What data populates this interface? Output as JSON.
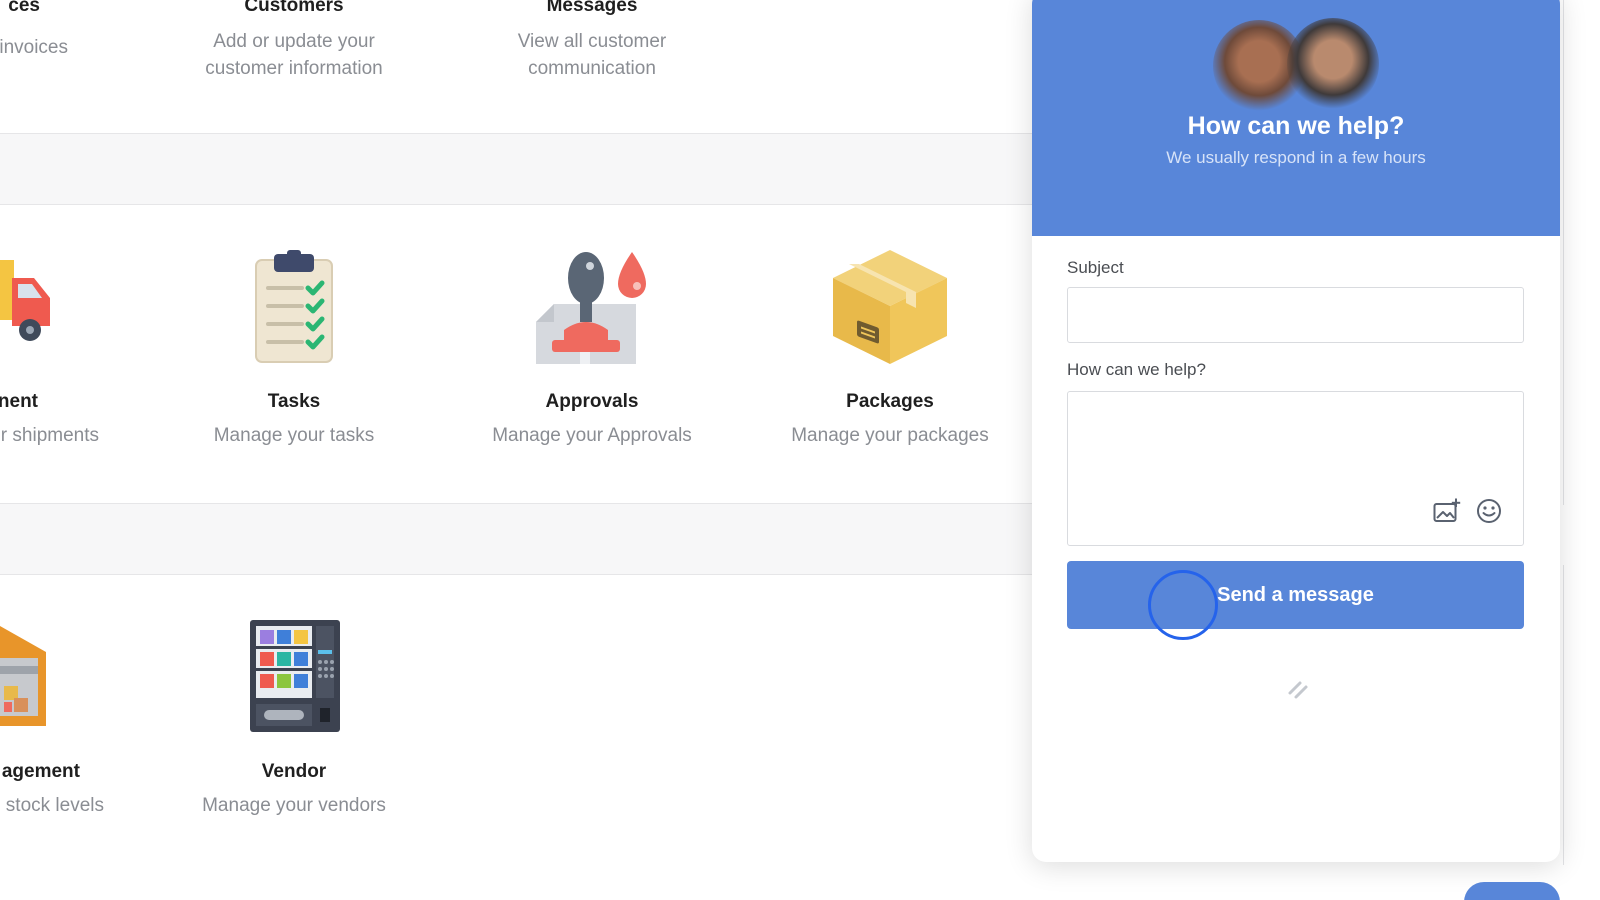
{
  "tiles_row1": [
    {
      "title": "ces",
      "desc": "invoices"
    },
    {
      "title": "Customers",
      "desc": "Add or update your customer information"
    },
    {
      "title": "Messages",
      "desc": "View all customer communication"
    }
  ],
  "tiles_row2": [
    {
      "title": "nent",
      "desc": "r shipments",
      "icon": "truck-icon"
    },
    {
      "title": "Tasks",
      "desc": "Manage your tasks",
      "icon": "clipboard-checklist-icon"
    },
    {
      "title": "Approvals",
      "desc": "Manage your Approvals",
      "icon": "rubber-stamp-icon"
    },
    {
      "title": "Packages",
      "desc": "Manage your packages",
      "icon": "package-box-icon"
    }
  ],
  "tiles_row3": [
    {
      "title": "agement",
      "desc": "stock levels",
      "icon": "warehouse-icon"
    },
    {
      "title": "Vendor",
      "desc": "Manage your vendors",
      "icon": "vending-machine-icon"
    }
  ],
  "widget": {
    "title": "How can we help?",
    "subtitle": "We usually respond in a few hours",
    "subject_label": "Subject",
    "subject_value": "",
    "help_label": "How can we help?",
    "help_value": "",
    "send_label": "Send a message",
    "icons": [
      "add-image-icon",
      "emoji-icon",
      "brand-logo-icon"
    ]
  },
  "colors": {
    "accent": "#5886d9",
    "cursor": "#2563eb",
    "muted_text": "#8a8d93"
  }
}
